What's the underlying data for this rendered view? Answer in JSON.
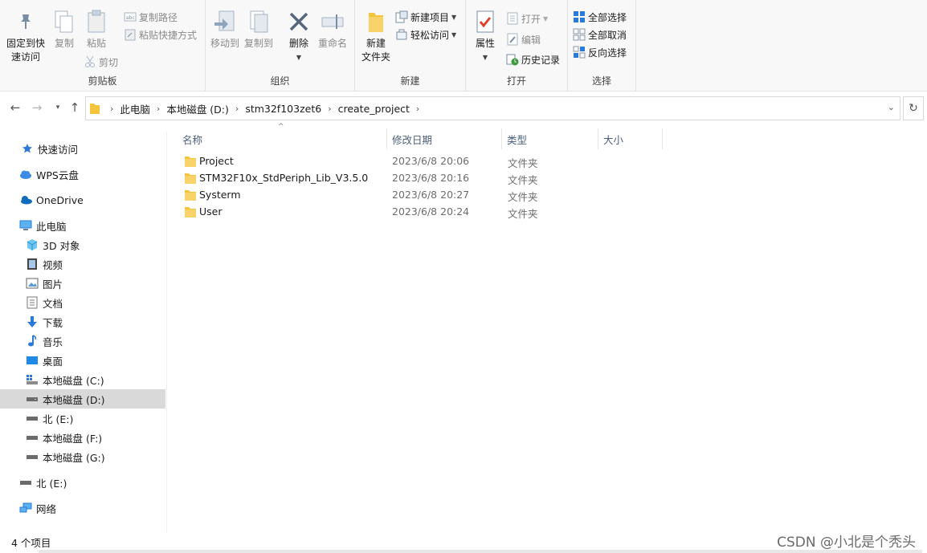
{
  "ribbon": {
    "clipboard": {
      "label": "剪贴板",
      "pin": "固定到快\n速访问",
      "copy": "复制",
      "paste": "粘贴",
      "copy_path": "复制路径",
      "paste_shortcut": "粘贴快捷方式",
      "cut": "剪切"
    },
    "organize": {
      "label": "组织",
      "move_to": "移动到",
      "copy_to": "复制到",
      "delete": "删除",
      "rename": "重命名"
    },
    "new": {
      "label": "新建",
      "new_folder": "新建\n文件夹",
      "new_item": "新建项目",
      "easy_access": "轻松访问"
    },
    "open": {
      "label": "打开",
      "properties": "属性",
      "open": "打开",
      "edit": "编辑",
      "history": "历史记录"
    },
    "select": {
      "label": "选择",
      "select_all": "全部选择",
      "select_none": "全部取消",
      "invert": "反向选择"
    }
  },
  "address": {
    "crumbs": [
      "此电脑",
      "本地磁盘 (D:)",
      "stm32f103zet6",
      "create_project"
    ]
  },
  "sidebar": {
    "items": [
      {
        "label": "快速访问",
        "icon": "star-icon"
      },
      {
        "label": "WPS云盘",
        "icon": "cloud-icon"
      },
      {
        "label": "OneDrive",
        "icon": "onedrive-icon"
      },
      {
        "label": "此电脑",
        "icon": "computer-icon"
      },
      {
        "label": "3D 对象",
        "icon": "cube-icon"
      },
      {
        "label": "视频",
        "icon": "video-icon"
      },
      {
        "label": "图片",
        "icon": "picture-icon"
      },
      {
        "label": "文档",
        "icon": "document-icon"
      },
      {
        "label": "下载",
        "icon": "download-icon"
      },
      {
        "label": "音乐",
        "icon": "music-icon"
      },
      {
        "label": "桌面",
        "icon": "desktop-icon"
      },
      {
        "label": "本地磁盘 (C:)",
        "icon": "system-drive-icon"
      },
      {
        "label": "本地磁盘 (D:)",
        "icon": "drive-icon"
      },
      {
        "label": "北 (E:)",
        "icon": "drive-icon"
      },
      {
        "label": "本地磁盘 (F:)",
        "icon": "drive-icon"
      },
      {
        "label": "本地磁盘 (G:)",
        "icon": "drive-icon"
      },
      {
        "label": "北 (E:)",
        "icon": "drive-icon"
      },
      {
        "label": "网络",
        "icon": "network-icon"
      }
    ]
  },
  "columns": {
    "name": "名称",
    "modified": "修改日期",
    "type": "类型",
    "size": "大小"
  },
  "files": [
    {
      "name": "Project",
      "modified": "2023/6/8 20:06",
      "type": "文件夹"
    },
    {
      "name": "STM32F10x_StdPeriph_Lib_V3.5.0",
      "modified": "2023/6/8 20:16",
      "type": "文件夹"
    },
    {
      "name": "Systerm",
      "modified": "2023/6/8 20:27",
      "type": "文件夹"
    },
    {
      "name": "User",
      "modified": "2023/6/8 20:24",
      "type": "文件夹"
    }
  ],
  "status": {
    "count": "4 个项目",
    "watermark": "CSDN @小北是个秃头"
  },
  "colors": {
    "folder": "#f5c43d",
    "selected": "#d9d9d9",
    "accent": "#2b79d8"
  }
}
